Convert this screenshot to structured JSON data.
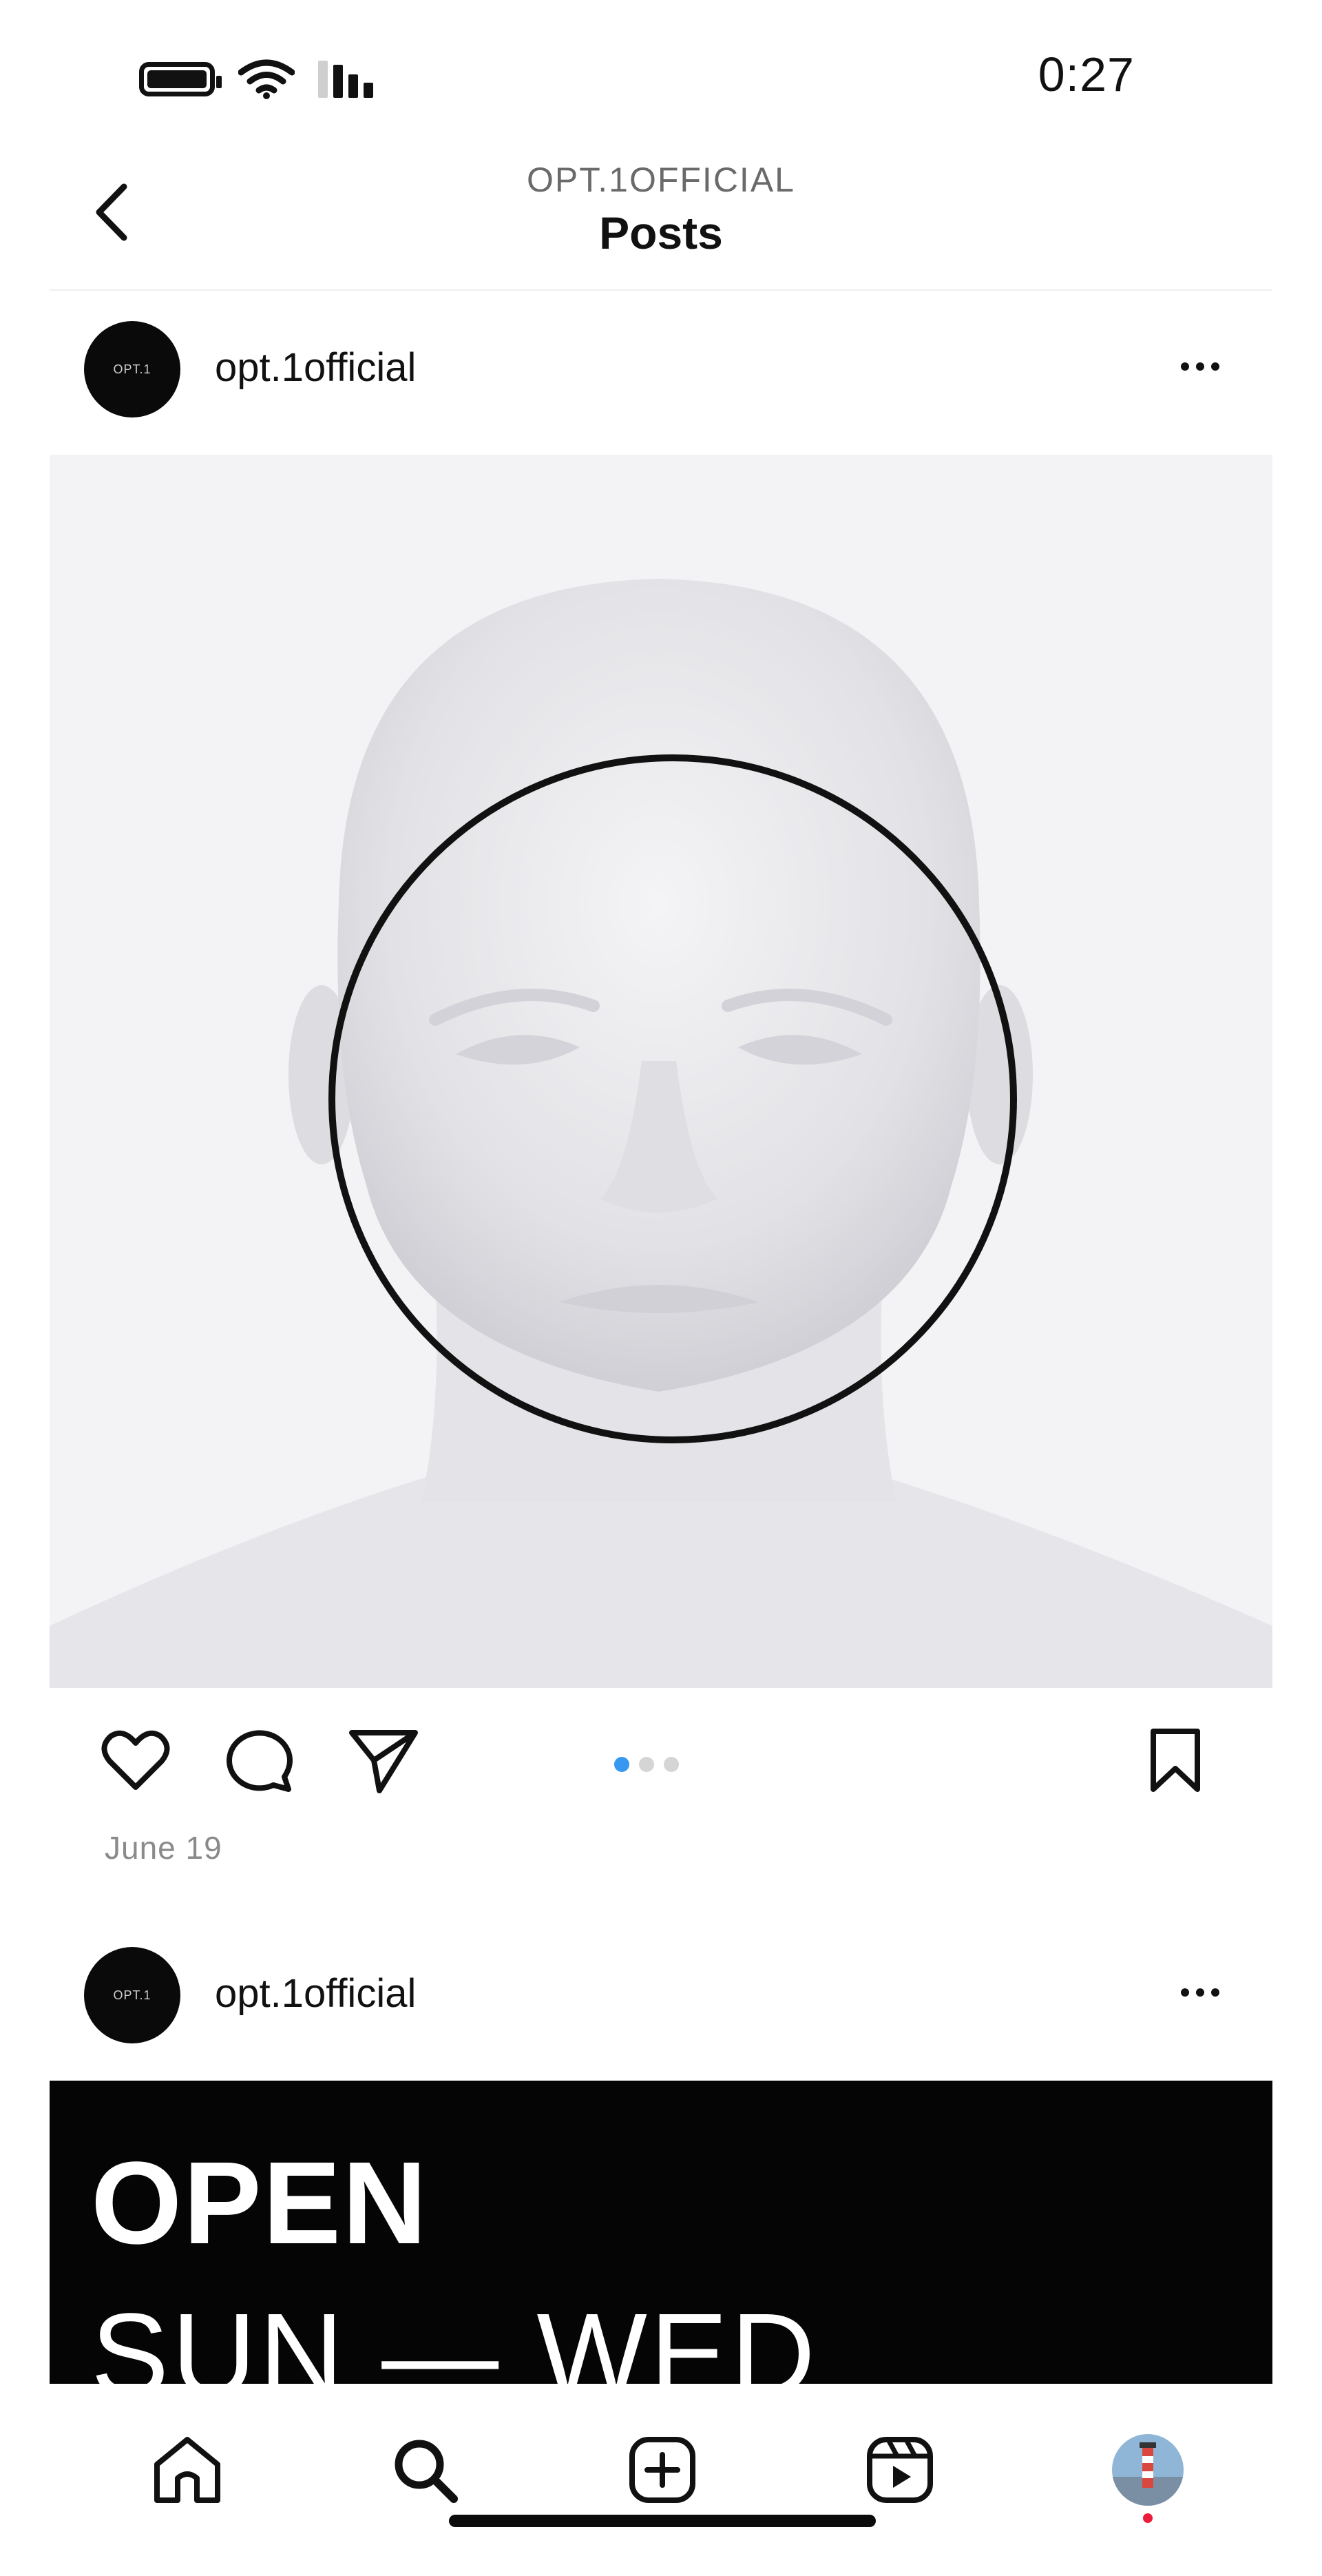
{
  "status_bar": {
    "time": "0:27"
  },
  "header": {
    "subtitle": "OPT.1OFFICIAL",
    "title": "Posts"
  },
  "posts": [
    {
      "username": "opt.1official",
      "avatar_text": "OPT.1",
      "date": "June 19",
      "carousel_count": 3,
      "carousel_active": 1
    },
    {
      "username": "opt.1official",
      "avatar_text": "OPT.1",
      "banner_line1": "OPEN",
      "banner_line2": "SUN — WED"
    }
  ],
  "icons": [
    "battery-icon",
    "wifi-icon",
    "signal-icon",
    "back-chevron-icon",
    "more-options-icon",
    "heart-icon",
    "comment-icon",
    "share-icon",
    "bookmark-icon",
    "home-icon",
    "search-icon",
    "new-post-icon",
    "reels-icon",
    "profile-avatar"
  ],
  "colors": {
    "accent_blue": "#3897f0",
    "notification_red": "#ed1c3a",
    "banner_bg": "#050505"
  }
}
